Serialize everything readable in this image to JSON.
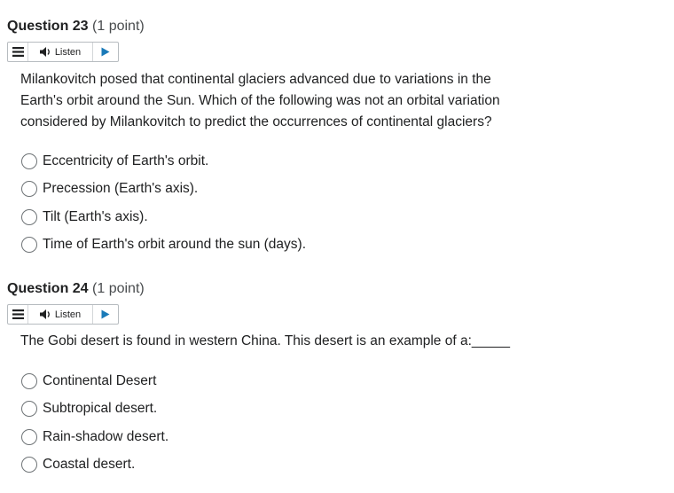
{
  "questions": [
    {
      "title": "Question 23",
      "points": "(1 point)",
      "listen_label": "Listen",
      "prompt": "Milankovitch posed that continental glaciers advanced due to variations in the Earth's orbit around the Sun. Which of the following was not an orbital variation considered by Milankovitch to predict the occurrences of continental glaciers?",
      "choices": [
        "Eccentricity of Earth's orbit.",
        "Precession (Earth's axis).",
        "Tilt (Earth's axis).",
        "Time of Earth's orbit around the sun (days)."
      ]
    },
    {
      "title": "Question 24",
      "points": "(1 point)",
      "listen_label": "Listen",
      "prompt": "The Gobi desert is found in western China. This desert is an example of a:_____",
      "choices": [
        "Continental Desert",
        "Subtropical desert.",
        "Rain-shadow desert.",
        "Coastal desert."
      ]
    }
  ],
  "icons": {
    "menu": "menu-icon",
    "speaker": "speaker-icon",
    "play": "play-icon"
  },
  "colors": {
    "play_accent": "#1a7ab8",
    "radio_border": "#6e7376",
    "text": "#202122"
  }
}
